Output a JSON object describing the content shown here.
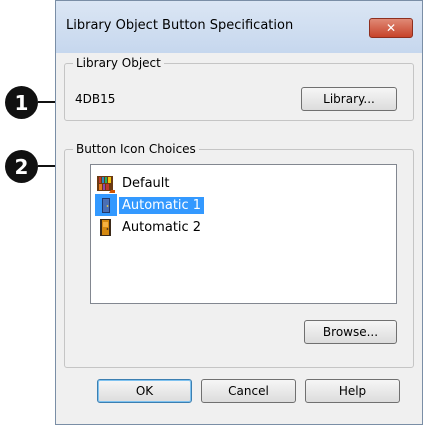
{
  "dialog": {
    "title": "Library Object Button Specification",
    "close_glyph": "✕"
  },
  "callouts": [
    "1",
    "2"
  ],
  "library_object": {
    "group_label": "Library Object",
    "value": "4DB15",
    "library_button": "Library..."
  },
  "button_icon_choices": {
    "group_label": "Button Icon Choices",
    "items": [
      {
        "label": "Default",
        "icon": "bookshelf-icon",
        "selected": false
      },
      {
        "label": "Automatic 1",
        "icon": "door-icon",
        "selected": true
      },
      {
        "label": "Automatic 2",
        "icon": "door-icon",
        "selected": false
      }
    ],
    "browse_button": "Browse..."
  },
  "footer": {
    "ok": "OK",
    "cancel": "Cancel",
    "help": "Help"
  },
  "colors": {
    "selection": "#3399ff",
    "close_button": "#c7432a",
    "title_bar": "#c6d7ee"
  }
}
